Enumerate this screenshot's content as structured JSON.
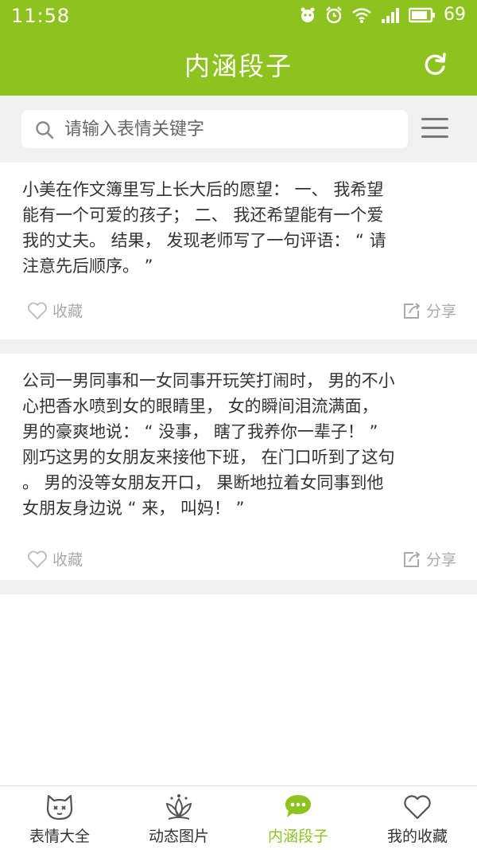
{
  "status": {
    "time": "11:58",
    "battery": "69"
  },
  "header": {
    "title": "内涵段子"
  },
  "search": {
    "placeholder": "请输入表情关键字"
  },
  "posts": [
    {
      "text": "小美在作文簿里写上长大后的愿望： 一、 我希望\n能有一个可爱的孩子； 二、 我还希望能有一个爱\n我的丈夫。 结果， 发现老师写了一句评语： “ 请\n注意先后顺序。 ”",
      "favorite_label": "收藏",
      "share_label": "分享"
    },
    {
      "text": "公司一男同事和一女同事开玩笑打闹时， 男的不小\n心把香水喷到女的眼睛里， 女的瞬间泪流满面，\n男的豪爽地说： “ 没事， 瞎了我养你一辈子！ ”\n刚巧这男的女朋友来接他下班， 在门口听到了这句\n。 男的没等女朋友开口， 果断地拉着女同事到他\n女朋友身边说 “ 来， 叫妈！ ”",
      "favorite_label": "收藏",
      "share_label": "分享"
    }
  ],
  "nav": {
    "items": [
      {
        "label": "表情大全",
        "icon": "cat-face-icon",
        "active": false
      },
      {
        "label": "动态图片",
        "icon": "lotus-icon",
        "active": false
      },
      {
        "label": "内涵段子",
        "icon": "chat-bubble-icon",
        "active": true
      },
      {
        "label": "我的收藏",
        "icon": "heart-icon",
        "active": false
      }
    ]
  },
  "colors": {
    "accent": "#8dc21f",
    "background_gray": "#f0f0f0"
  }
}
